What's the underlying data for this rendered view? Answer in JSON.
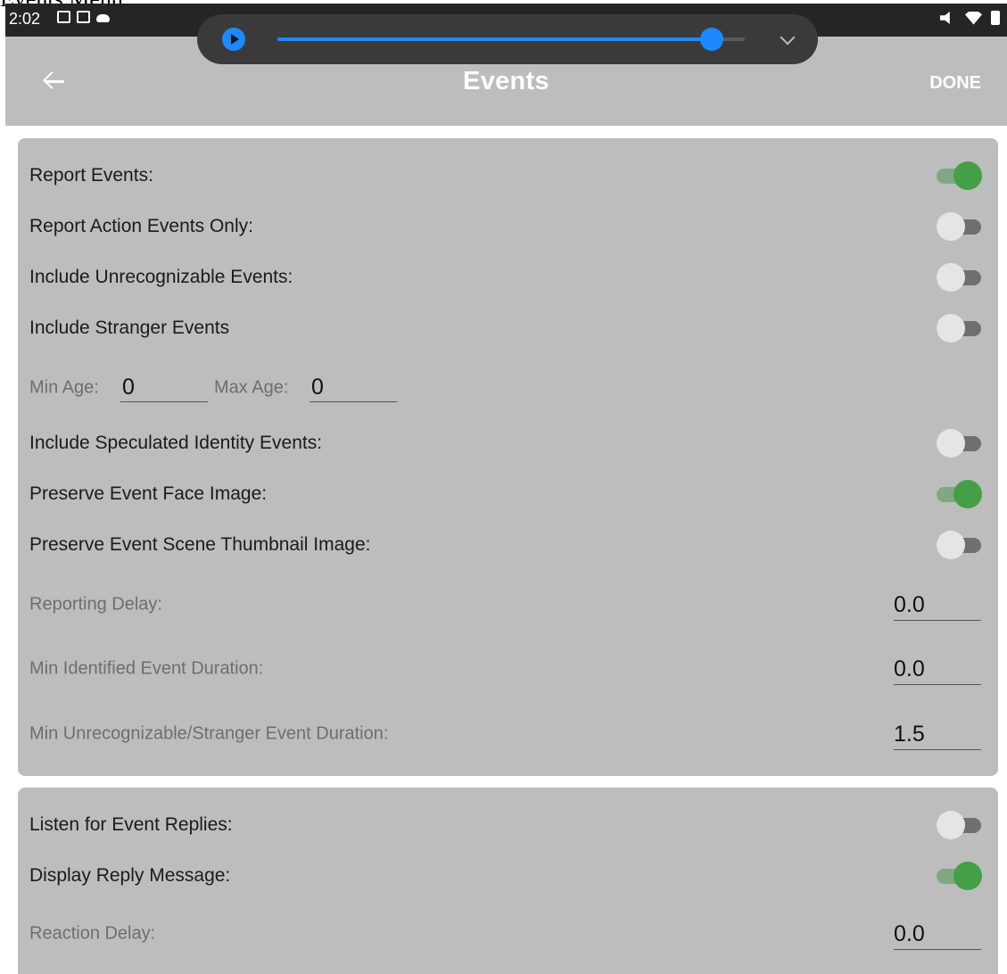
{
  "caption": "Events Menu:",
  "status_bar": {
    "time": "2:02",
    "left_icons": [
      "gallery-icon",
      "gmail-icon",
      "cloud-icon"
    ],
    "right_icons": [
      "mute-icon",
      "wifi-icon",
      "battery-icon"
    ]
  },
  "media_player": {
    "progress": 0.93,
    "accent": "#1e88ff"
  },
  "app_bar": {
    "title": "Events",
    "done_label": "DONE"
  },
  "events_card": {
    "report_events": {
      "label": "Report Events:",
      "on": true
    },
    "report_action_only": {
      "label": "Report Action Events Only:",
      "on": false
    },
    "include_unrecognizable": {
      "label": "Include Unrecognizable Events:",
      "on": false
    },
    "include_stranger": {
      "label": "Include Stranger Events",
      "on": false
    },
    "min_age": {
      "label": "Min Age:",
      "value": "0"
    },
    "max_age": {
      "label": "Max Age:",
      "value": "0"
    },
    "include_speculated": {
      "label": "Include Speculated Identity Events:",
      "on": false
    },
    "preserve_face": {
      "label": "Preserve Event Face Image:",
      "on": true
    },
    "preserve_scene": {
      "label": "Preserve Event Scene Thumbnail Image:",
      "on": false
    },
    "reporting_delay": {
      "label": "Reporting Delay:",
      "value": "0.0"
    },
    "min_identified_duration": {
      "label": "Min Identified Event Duration:",
      "value": "0.0"
    },
    "min_unrecognizable_duration": {
      "label": "Min Unrecognizable/Stranger Event Duration:",
      "value": "1.5"
    }
  },
  "replies_card": {
    "listen_replies": {
      "label": "Listen for Event Replies:",
      "on": false
    },
    "display_reply": {
      "label": "Display Reply Message:",
      "on": true
    },
    "reaction_delay": {
      "label": "Reaction Delay:",
      "value": "0.0"
    }
  },
  "colors": {
    "toggle_on": "#43a047",
    "panel": "#bdbdbd",
    "status_bar": "#252525"
  }
}
